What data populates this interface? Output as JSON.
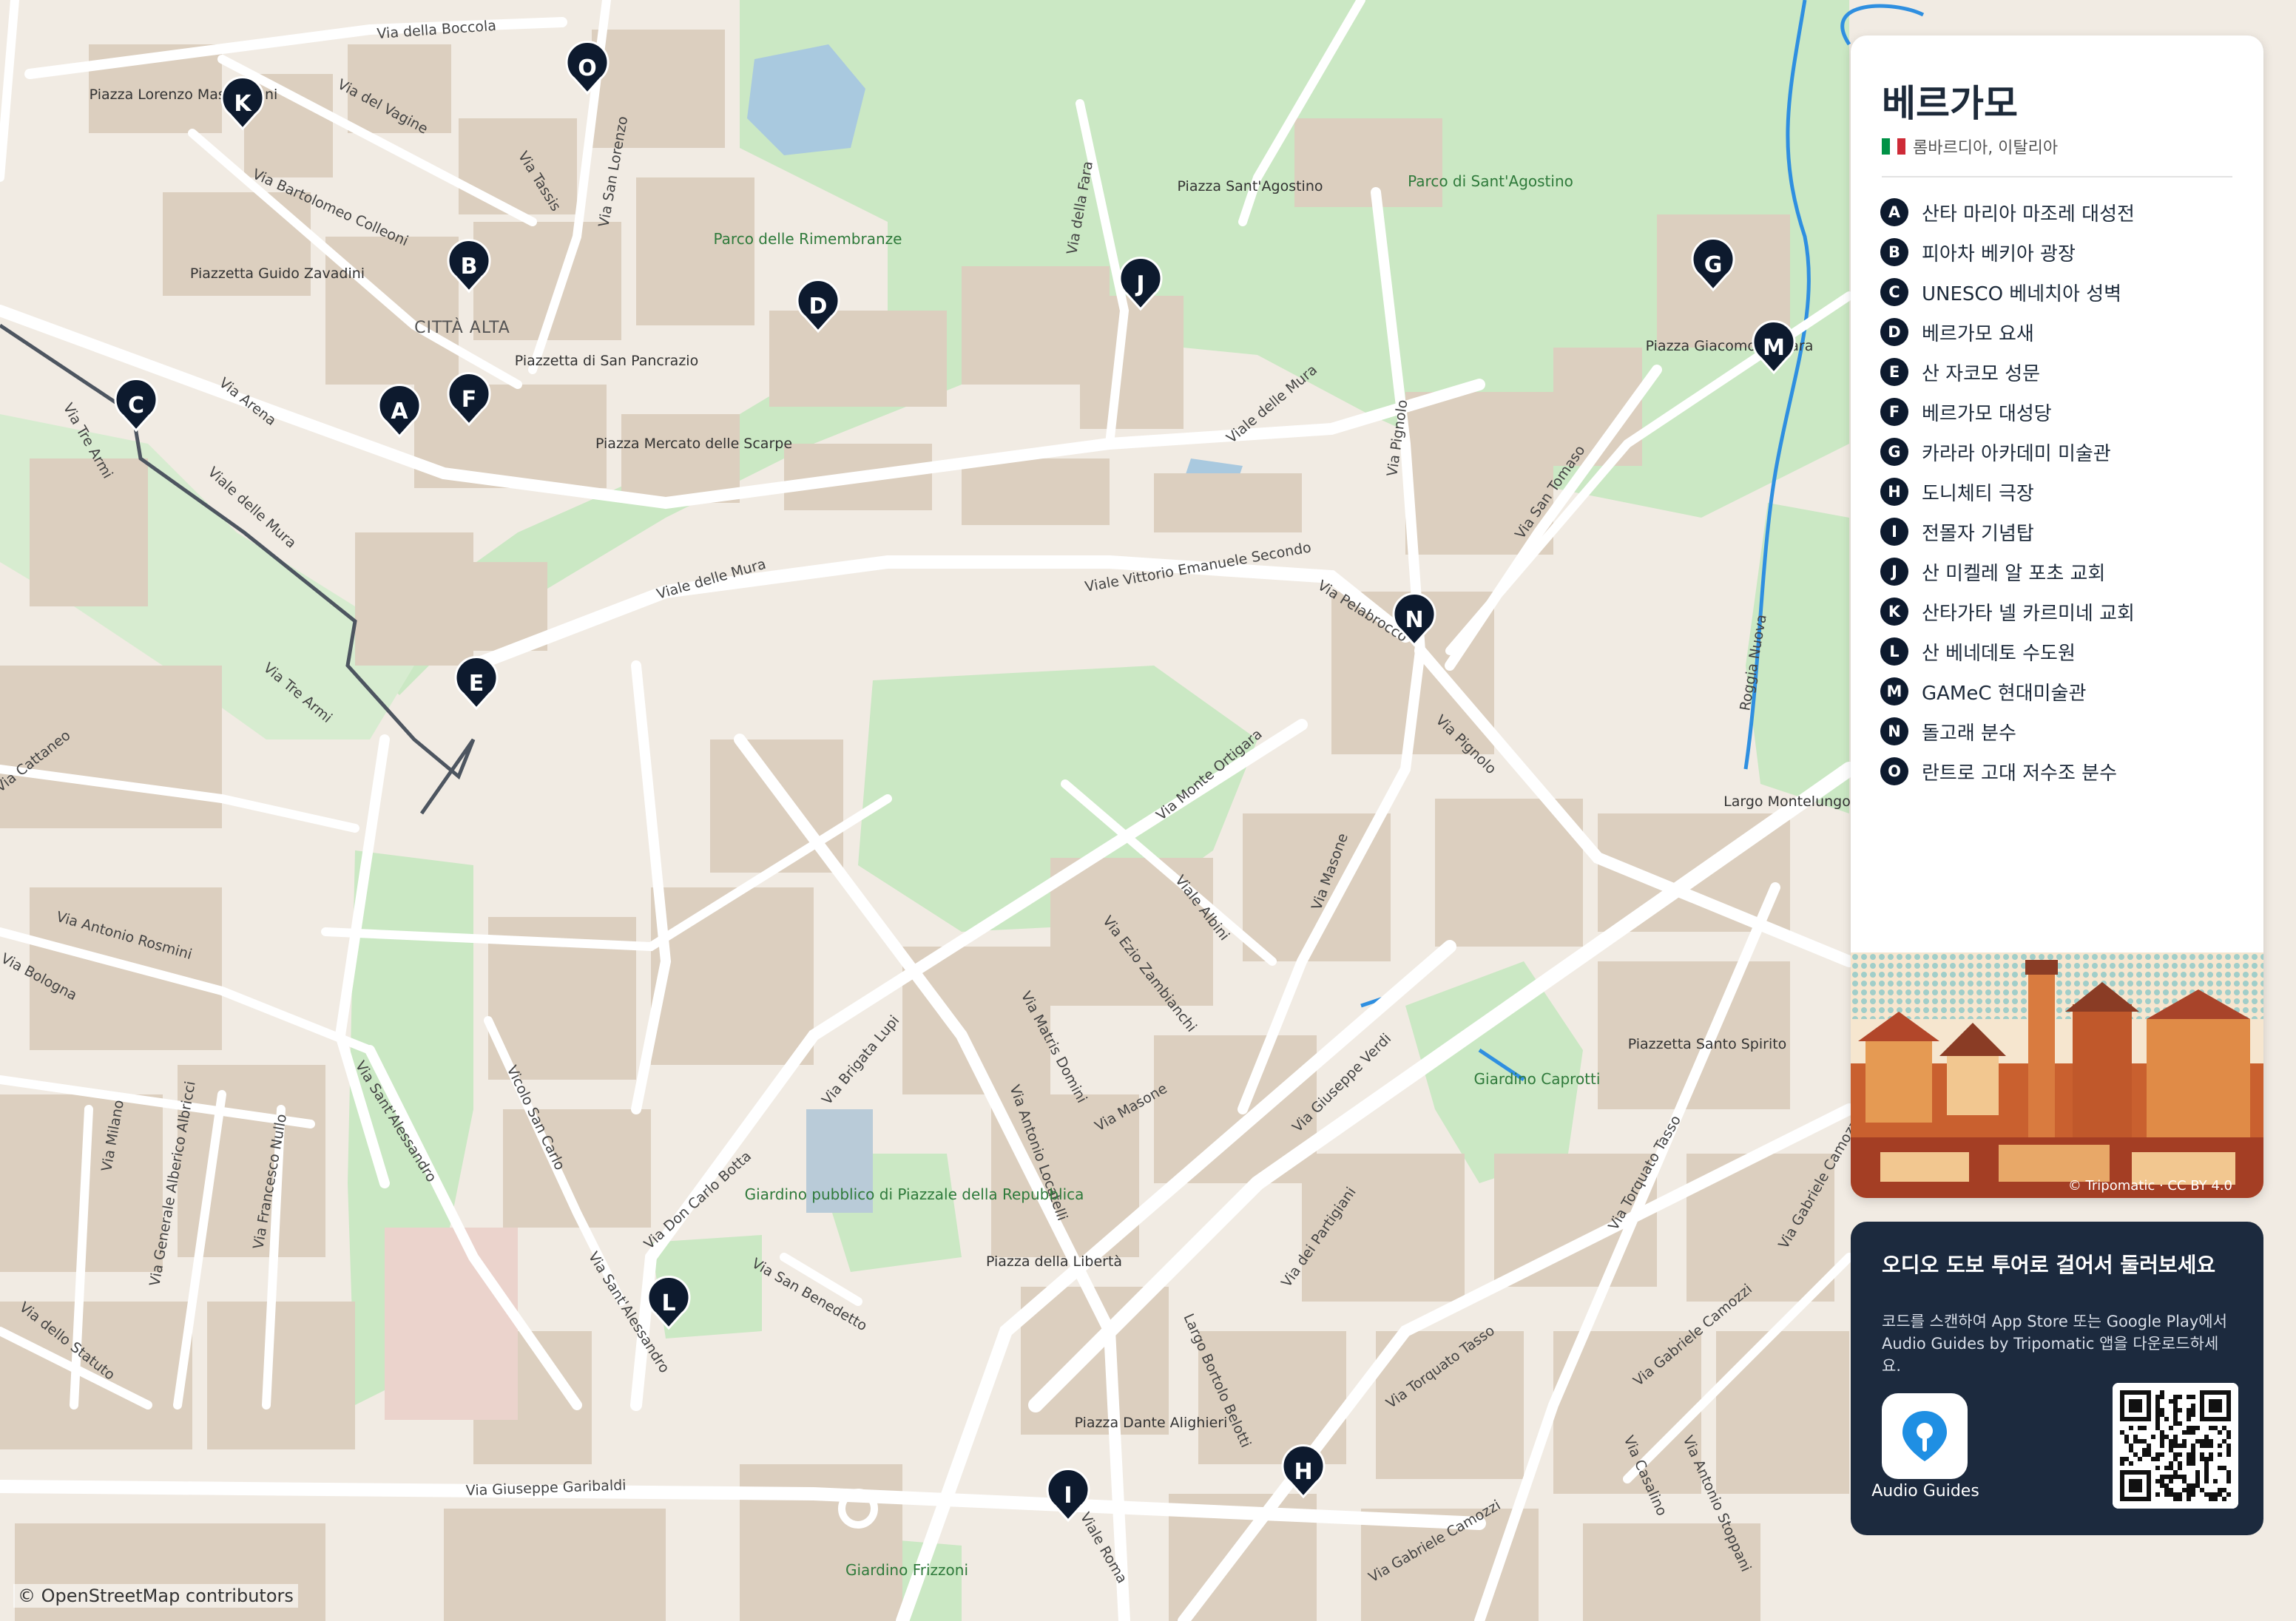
{
  "map": {
    "attribution": "© OpenStreetMap contributors",
    "streets": [
      "Via della Boccola",
      "Via del Vagine",
      "Via Tassis",
      "Via San Lorenzo",
      "Via Bartolomeo Colleoni",
      "Via Arena",
      "Via Tre Armi",
      "Viale delle Mura",
      "Via della Fara",
      "Viale delle Mura",
      "Viale delle Mura",
      "Via Pignolo",
      "Via San Tomaso",
      "Viale Vittorio Emanuele Secondo",
      "Via Pelabrocco",
      "Via Tre Armi",
      "Via Pignolo",
      "Roggia Nuova",
      "Via Cattaneo",
      "Via Monte Ortigara",
      "Viale Albini",
      "Via Masone",
      "Via Antonio Rosmini",
      "Via Bologna",
      "Via Ezio Zambianchi",
      "Via Matris Domini",
      "Via Brigata Lupi",
      "Via Sant'Alessandro",
      "Vicolo San Carlo",
      "Via Antonio Locatelli",
      "Via Masone",
      "Via Giuseppe Verdi",
      "Via Milano",
      "Via Generale Alberico Albricci",
      "Via Francesco Nullo",
      "Via Don Carlo Botta",
      "Via San Benedetto",
      "Via Sant'Alessandro",
      "Via dello Statuto",
      "Largo Bortolo Belotti",
      "Via dei Partigiani",
      "Via Torquato Tasso",
      "Via Torquato Tasso",
      "Via Gabriele Camozzi",
      "Via Gabriele Camozzi",
      "Via Giuseppe Garibaldi",
      "Viale Roma",
      "Via Gabriele Camozzi",
      "Via Casalino",
      "Via Antonio Stoppani"
    ],
    "places": [
      "Piazza Lorenzo Mascheroni",
      "Piazzetta Guido Zavadini",
      "CITTÀ ALTA",
      "Piazzetta di San Pancrazio",
      "Piazza Mercato delle Scarpe",
      "Piazza Sant'Agostino",
      "Piazza Giacomo Carrara",
      "Largo Montelungo",
      "Piazzetta Santo Spirito",
      "Piazza della Libertà",
      "Piazza Dante Alighieri"
    ],
    "parks": [
      "Parco delle Rimembranze",
      "Parco di Sant'Agostino",
      "Giardino Caprotti",
      "Giardino pubblico di Piazzale della Repubblica",
      "Giardino Frizzoni"
    ],
    "pins": [
      "O",
      "K",
      "B",
      "D",
      "J",
      "G",
      "M",
      "C",
      "A",
      "F",
      "N",
      "E",
      "L",
      "I",
      "H"
    ]
  },
  "sidebar": {
    "title": "베르가모",
    "region": "롬바르디아, 이탈리아",
    "flag_colors": [
      "#009246",
      "#ffffff",
      "#ce2b37"
    ],
    "pois": [
      {
        "letter": "A",
        "name": "산타 마리아 마조레 대성전"
      },
      {
        "letter": "B",
        "name": "피아차 베키아 광장"
      },
      {
        "letter": "C",
        "name": "UNESCO 베네치아 성벽"
      },
      {
        "letter": "D",
        "name": "베르가모 요새"
      },
      {
        "letter": "E",
        "name": "산 자코모 성문"
      },
      {
        "letter": "F",
        "name": "베르가모 대성당"
      },
      {
        "letter": "G",
        "name": "카라라 아카데미 미술관"
      },
      {
        "letter": "H",
        "name": "도니체티 극장"
      },
      {
        "letter": "I",
        "name": "전몰자 기념탑"
      },
      {
        "letter": "J",
        "name": "산 미켈레 알 포초 교회"
      },
      {
        "letter": "K",
        "name": "산타가타 넬 카르미네 교회"
      },
      {
        "letter": "L",
        "name": "산 베네데토 수도원"
      },
      {
        "letter": "M",
        "name": "GAMeC 현대미술관"
      },
      {
        "letter": "N",
        "name": "돌고래 분수"
      },
      {
        "letter": "O",
        "name": "란트로 고대 저수조 분수"
      }
    ],
    "illustration_credit": "© Tripomatic · CC BY 4.0"
  },
  "audio": {
    "title": "오디오 도보 투어로 걸어서 둘러보세요",
    "description": "코드를 스캔하여 App Store 또는 Google Play에서 Audio Guides by Tripomatic 앱을 다운로드하세요.",
    "app_label": "Audio Guides",
    "icon": "audio-guides-pin-icon"
  },
  "colors": {
    "pin": "#0d1a2e",
    "park": "#c8e8c0",
    "road": "#ffffff",
    "building": "#dcd0c2",
    "water": "#2f8fe0",
    "wall": "#4d5560"
  }
}
